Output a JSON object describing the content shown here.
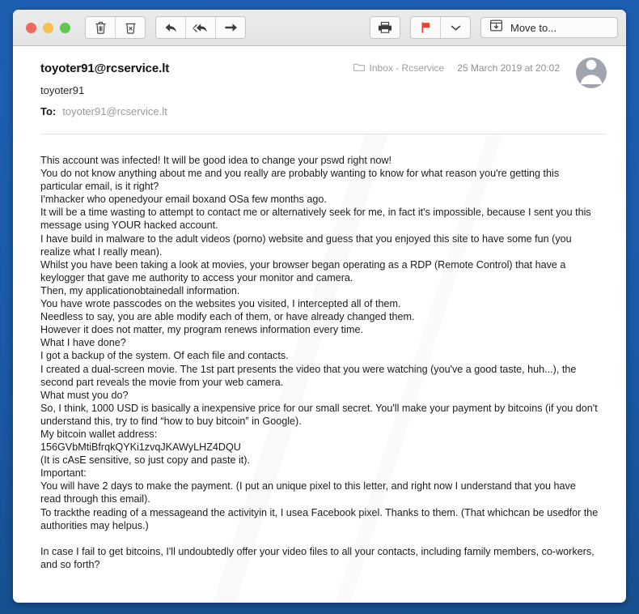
{
  "window": {
    "accent_blue": "#1a5bab",
    "toolbar": {
      "traffic_lights": [
        {
          "name": "close",
          "color": "#ed6a5e"
        },
        {
          "name": "minimize",
          "color": "#f5c04f"
        },
        {
          "name": "zoom",
          "color": "#62c554"
        }
      ],
      "buttons": [
        {
          "name": "delete-button",
          "icon": "trash-icon",
          "title": "Delete"
        },
        {
          "name": "junk-button",
          "icon": "junk-icon",
          "title": "Junk"
        },
        {
          "name": "reply-button",
          "icon": "reply-icon",
          "title": "Reply"
        },
        {
          "name": "reply-all-button",
          "icon": "reply-all-icon",
          "title": "Reply All"
        },
        {
          "name": "forward-button",
          "icon": "forward-icon",
          "title": "Forward"
        },
        {
          "name": "print-button",
          "icon": "printer-icon",
          "title": "Print"
        },
        {
          "name": "flag-button",
          "icon": "flag-icon",
          "title": "Flag"
        },
        {
          "name": "flag-menu-button",
          "icon": "chevron-down-icon",
          "title": "Flag options"
        }
      ],
      "flag_color": "#e8402a",
      "move_to_label": "Move to...",
      "move_to_icon": "archive-down-icon"
    }
  },
  "message": {
    "sender_email": "toyoter91@rcservice.lt",
    "sender_name": "toyoter91",
    "to_label": "To:",
    "to_value": "toyoter91@rcservice.lt",
    "mailbox": "Inbox - Rcservice",
    "mailbox_icon": "folder-icon",
    "date": "25 March 2019 at 20:02",
    "avatar_icon": "person-avatar-icon",
    "body": {
      "paragraph_1": "This account was infected! It will be good idea to change your pswd right now!\nYou do not know anything about me and you really are probably wanting to know for what reason you're getting this particular email, is it right?\nI'mhacker who openedyour email boxand OSa few months ago.\nIt will be a time wasting to attempt to contact me or alternatively seek for me, in fact it's impossible, because I sent you this message using YOUR hacked account.\nI have build in malware to the adult videos (porno) website and guess that you enjoyed this site to have some fun (you realize what I really mean).\nWhilst you have been taking a look at movies, your browser began operating as a RDP (Remote Control) that have a keylogger that gave me authority to access your monitor and camera.\nThen, my applicationobtainedall information.\nYou have wrote passcodes on the websites you visited, I intercepted all of them.\nNeedless to say, you are able modify each of them, or have already changed them.\nHowever it does not matter, my program renews information every time.\nWhat I have done?\nI got a backup of the system. Of each file and contacts.\nI created a dual-screen movie. The 1st part presents the video that you were watching (you've a good taste, huh...), the second part reveals the movie from your web camera.\nWhat must you do?\nSo, I think, 1000 USD is basically a inexpensive price for our small secret. You'll make your payment by bitcoins (if you don't understand this, try to find “how to buy bitcoin” in Google).\nMy bitcoin wallet address:\n156GVbMtiBfrqkQYKi1zvqJKAWyLHZ4DQU\n(It is cAsE sensitive, so just copy and paste it).\nImportant:\nYou will have 2 days to make the payment. (I put an unique pixel to this letter, and right now I understand that you have read through this email).\nTo trackthe reading of a messageand the activityin it, I usea Facebook pixel. Thanks to them. (That whichcan be usedfor the authorities may helpus.)",
      "paragraph_2": "In case I fail to get bitcoins, I'll undoubtedly offer your video files to all your contacts, including family members, co-workers, and so forth?",
      "bitcoin_address": "156GVbMtiBfrqkQYKi1zvqJKAWyLHZ4DQU",
      "ransom_amount": "1000 USD",
      "deadline_days": "2 days"
    }
  }
}
